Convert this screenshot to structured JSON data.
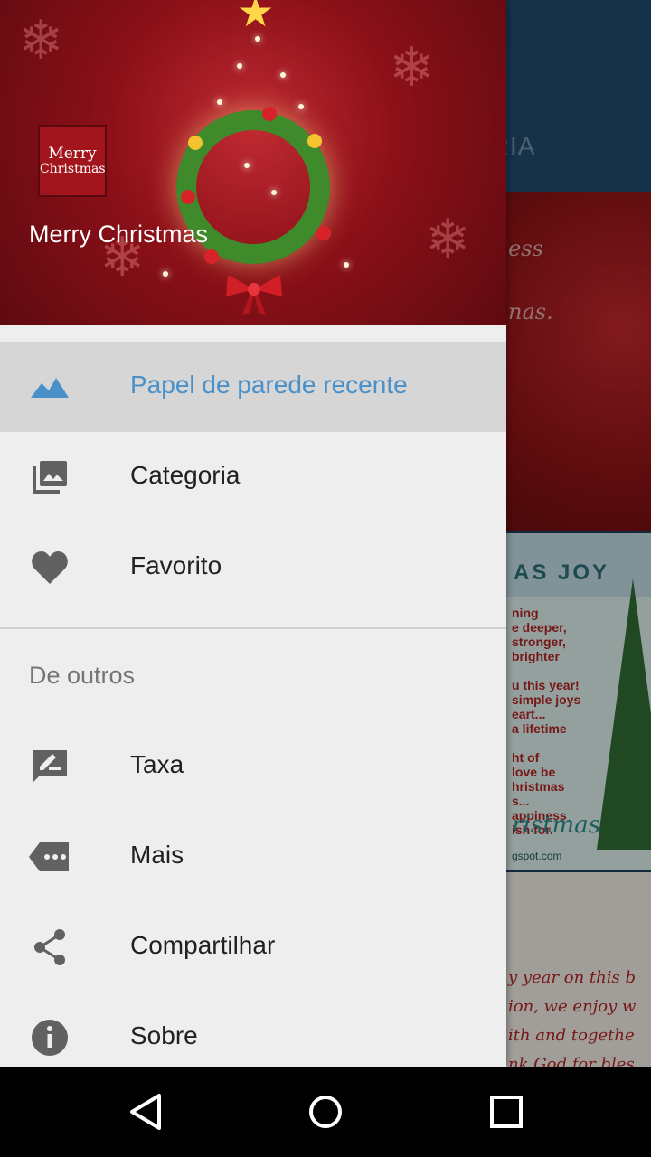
{
  "background_app": {
    "tab_label_partial": "ORIA",
    "card1_text": "ess\nnas.",
    "card2_header": "AS JOY",
    "card2_body": "ning\ne deeper,\nstronger,\nbrighter\n\nu this year!\nsimple joys\neart...\na lifetime\n\nht of\nlove be\nhristmas\ns...\nappiness\nish for.",
    "card2_signature": "ristmas",
    "card2_footer": "gspot.com",
    "card3_text": "y year on this b\nion, we enjoy w\nith and togethe\nnk God for bles"
  },
  "drawer": {
    "header": {
      "logo_line1": "Merry",
      "logo_line2": "Christmas",
      "title": "Merry Christmas"
    },
    "items": [
      {
        "label": "Papel de parede recente",
        "icon": "landscape-icon",
        "active": true
      },
      {
        "label": "Categoria",
        "icon": "photo-library-icon",
        "active": false
      },
      {
        "label": "Favorito",
        "icon": "heart-icon",
        "active": false
      }
    ],
    "section_title": "De outros",
    "other_items": [
      {
        "label": "Taxa",
        "icon": "rate-review-icon"
      },
      {
        "label": "Mais",
        "icon": "more-tag-icon"
      },
      {
        "label": "Compartilhar",
        "icon": "share-icon"
      },
      {
        "label": "Sobre",
        "icon": "info-icon"
      }
    ]
  },
  "navbar": {
    "buttons": [
      "back-icon",
      "home-icon",
      "recents-icon"
    ]
  },
  "colors": {
    "active_label": "#4a90c9",
    "icon_gray": "#616161",
    "drawer_bg": "#eeeeee",
    "active_bg": "#d6d6d6",
    "toolbar": "#1f4a6c"
  }
}
